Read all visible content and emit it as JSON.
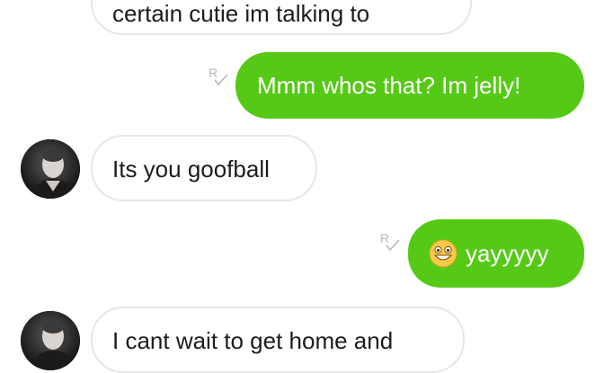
{
  "messages": [
    {
      "direction": "incoming",
      "text": "certain cutie im talking to"
    },
    {
      "direction": "outgoing",
      "text": "Mmm whos that? Im jelly!",
      "receipt_icon": "read-receipt-icon"
    },
    {
      "direction": "incoming",
      "text": "Its you goofball",
      "avatar_icon": "contact-avatar"
    },
    {
      "direction": "outgoing",
      "emoji_icon": "smiling-face-emoji",
      "text": "yayyyyy",
      "receipt_icon": "read-receipt-icon"
    },
    {
      "direction": "incoming",
      "text": "I cant wait to get home and",
      "avatar_icon": "contact-avatar"
    }
  ],
  "colors": {
    "outgoing_bubble": "#56c917",
    "incoming_border": "#e6e6e6",
    "receipt": "#b8b8b8"
  }
}
